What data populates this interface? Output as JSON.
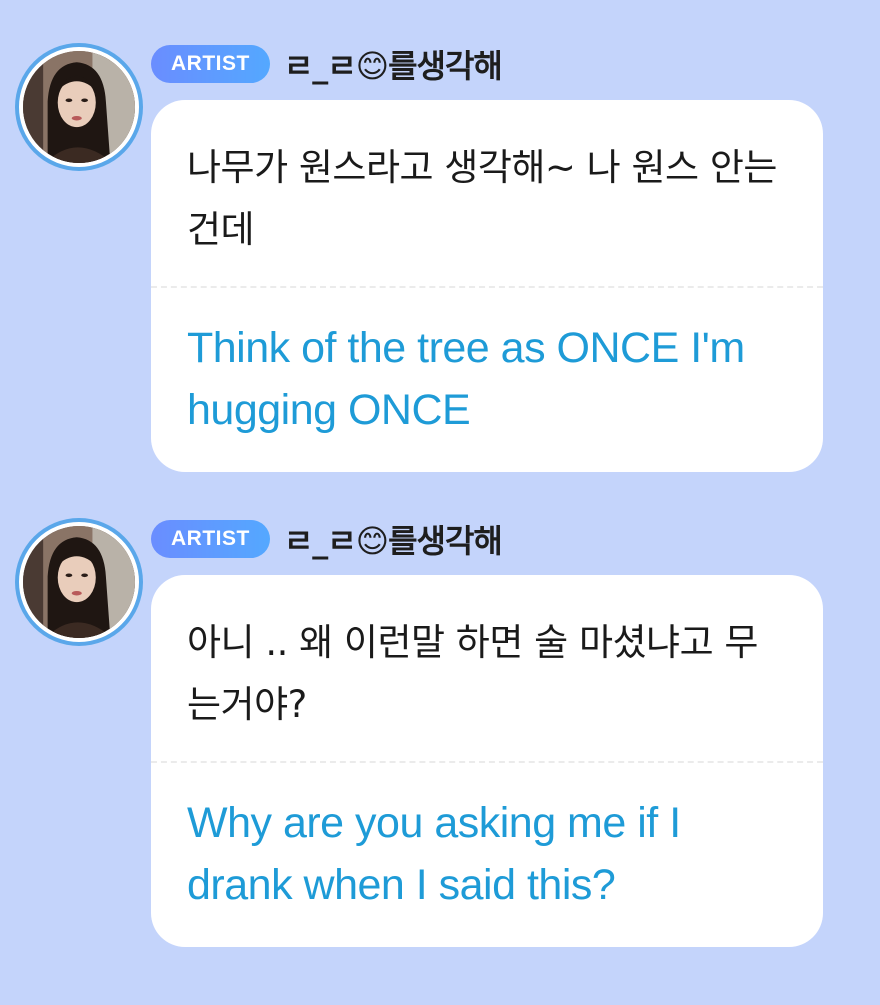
{
  "colors": {
    "background": "#c4d4fb",
    "badge_start": "#6a8dff",
    "badge_end": "#54a8ff",
    "translation": "#1e9bd7",
    "avatar_ring": "#5aa7ea"
  },
  "messages": [
    {
      "badge": "ARTIST",
      "author": "ㄹ_ㄹ😊를생각해",
      "original": "나무가 원스라고 생각해~ 나 원스 안는건데",
      "translation": "Think of the tree as ONCE I'm hugging ONCE"
    },
    {
      "badge": "ARTIST",
      "author": "ㄹ_ㄹ😊를생각해",
      "original": "아니 .. 왜 이런말 하면 술 마셨냐고 무는거야?",
      "translation": "Why are you asking me if I drank when I said this?"
    }
  ]
}
